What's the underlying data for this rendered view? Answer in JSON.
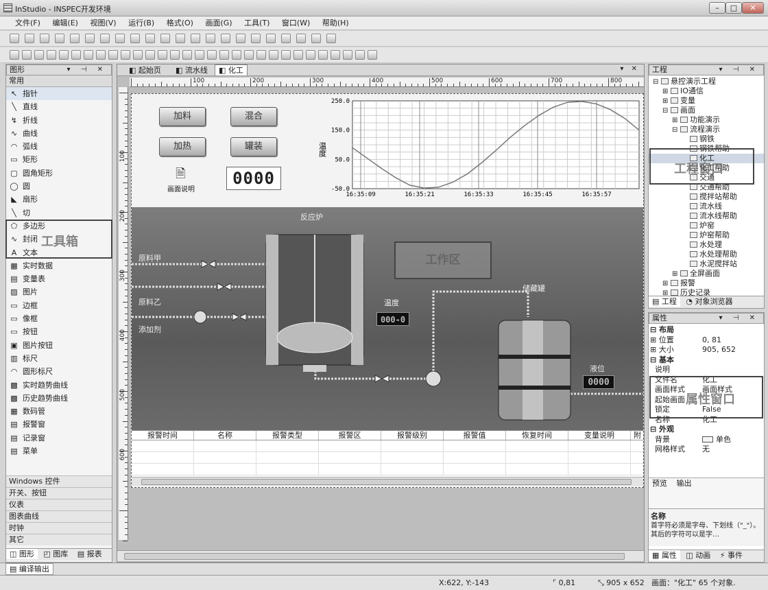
{
  "window": {
    "title": "InStudio - INSPEC开发环境",
    "controls": [
      "–",
      "□",
      "✕"
    ]
  },
  "menu": [
    "文件(F)",
    "编辑(E)",
    "视图(V)",
    "运行(B)",
    "格式(O)",
    "画面(G)",
    "工具(T)",
    "窗口(W)",
    "帮助(H)"
  ],
  "toolbox": {
    "title": "图形",
    "section": "常用",
    "items": [
      "指针",
      "直线",
      "折线",
      "曲线",
      "弧线",
      "矩形",
      "圆角矩形",
      "圆",
      "扇形",
      "切",
      "多边形",
      "封闭",
      "文本",
      "实时数据",
      "变量表",
      "图片",
      "边框",
      "像框",
      "按钮",
      "图片按钮",
      "标尺",
      "圆形标尺",
      "实时趋势曲线",
      "历史趋势曲线",
      "数码管",
      "报警窗",
      "记录窗",
      "菜单"
    ],
    "icons": [
      "pointer-icon",
      "line-icon",
      "polyline-icon",
      "curve-icon",
      "arc-icon",
      "rect-icon",
      "roundrect-icon",
      "circle-icon",
      "pie-icon",
      "chord-icon",
      "polygon-icon",
      "closed-curve-icon",
      "text-icon",
      "realtime-data-icon",
      "var-table-icon",
      "picture-icon",
      "border-icon",
      "frame-icon",
      "button-icon",
      "picture-button-icon",
      "ruler-icon",
      "circle-ruler-icon",
      "realtime-trend-icon",
      "history-trend-icon",
      "digital-tube-icon",
      "alarm-window-icon",
      "record-window-icon",
      "menu-icon"
    ],
    "glyphs": [
      "↖",
      "╲",
      "↯",
      "∿",
      "◠",
      "▭",
      "▢",
      "◯",
      "◣",
      "╲",
      "⬠",
      "∿",
      "A",
      "▦",
      "▤",
      "▨",
      "▭",
      "▭",
      "▭",
      "▣",
      "▥",
      "◠",
      "▩",
      "▩",
      "▦",
      "▤",
      "▤",
      "▤"
    ],
    "overlay": "工具箱",
    "categories": [
      "Windows 控件",
      "开关、按钮",
      "仪表",
      "图表曲线",
      "时钟",
      "其它"
    ],
    "bottom_tabs": [
      "图形",
      "图库",
      "报表"
    ]
  },
  "doc_tabs": [
    "起始页",
    "流水线",
    "化工"
  ],
  "ruler": {
    "h_labels": [
      "100",
      "200",
      "300",
      "400",
      "500",
      "600",
      "700",
      "800"
    ],
    "v_labels": [
      "100",
      "200",
      "300",
      "400",
      "500",
      "600"
    ]
  },
  "canvas": {
    "buttons": [
      "加料",
      "混合",
      "加热",
      "罐装"
    ],
    "help_label": "画面说明",
    "counter": "0000",
    "reactor_label": "反应炉",
    "materials": [
      "原料甲",
      "原料乙",
      "添加剂"
    ],
    "temp_label": "温度",
    "temp_value": "000-0",
    "tank_label": "储藏罐",
    "level_label": "液位",
    "level_value": "0000",
    "work_area": "工作区",
    "alarm_cols": [
      "报警时间",
      "名称",
      "报警类型",
      "报警区",
      "报警级别",
      "报警值",
      "恢复时间",
      "变量说明",
      "附"
    ]
  },
  "chart_data": {
    "type": "line",
    "ylabel": "温度",
    "y_ticks": [
      "250.0",
      "150.0",
      "50.0",
      "-50.0"
    ],
    "x_ticks": [
      "16:35:09",
      "16:35:21",
      "16:35:33",
      "16:35:45",
      "16:35:57"
    ],
    "ylim": [
      -50,
      250
    ],
    "series": [
      {
        "x": [
          0,
          0.05,
          0.1,
          0.15,
          0.2,
          0.25,
          0.3,
          0.35,
          0.4,
          0.45,
          0.5,
          0.55,
          0.6,
          0.65,
          0.7,
          0.75,
          0.8,
          0.85,
          0.9,
          0.95,
          1.0
        ],
        "values": [
          90,
          55,
          20,
          -12,
          -38,
          -48,
          -45,
          -28,
          0,
          38,
          80,
          125,
          165,
          200,
          228,
          245,
          248,
          240,
          220,
          190,
          150
        ]
      }
    ],
    "grid": true
  },
  "project": {
    "title": "工程",
    "overlay": "工程窗口",
    "tree": [
      {
        "d": 0,
        "t": "悬控演示工程",
        "i": "⊟"
      },
      {
        "d": 1,
        "t": "IO通信",
        "i": "⊞"
      },
      {
        "d": 1,
        "t": "变量",
        "i": "⊞"
      },
      {
        "d": 1,
        "t": "画面",
        "i": "⊟"
      },
      {
        "d": 2,
        "t": "功能演示",
        "i": "⊞"
      },
      {
        "d": 2,
        "t": "流程演示",
        "i": "⊟"
      },
      {
        "d": 3,
        "t": "钢铁",
        "i": ""
      },
      {
        "d": 3,
        "t": "钢铁帮助",
        "i": ""
      },
      {
        "d": 3,
        "t": "化工",
        "i": ""
      },
      {
        "d": 3,
        "t": "化工帮助",
        "i": ""
      },
      {
        "d": 3,
        "t": "交通",
        "i": ""
      },
      {
        "d": 3,
        "t": "交通帮助",
        "i": ""
      },
      {
        "d": 3,
        "t": "搅拌站帮助",
        "i": ""
      },
      {
        "d": 3,
        "t": "流水线",
        "i": ""
      },
      {
        "d": 3,
        "t": "流水线帮助",
        "i": ""
      },
      {
        "d": 3,
        "t": "炉窑",
        "i": ""
      },
      {
        "d": 3,
        "t": "炉窑帮助",
        "i": ""
      },
      {
        "d": 3,
        "t": "水处理",
        "i": ""
      },
      {
        "d": 3,
        "t": "水处理帮助",
        "i": ""
      },
      {
        "d": 3,
        "t": "水泥搅拌站",
        "i": ""
      },
      {
        "d": 2,
        "t": "全屏画面",
        "i": "⊞"
      },
      {
        "d": 1,
        "t": "报警",
        "i": "⊞"
      },
      {
        "d": 1,
        "t": "历史记录",
        "i": "⊞"
      }
    ],
    "tabs": [
      "工程",
      "对象浏览器"
    ]
  },
  "properties": {
    "title": "属性",
    "overlay": "属性窗口",
    "rows": [
      {
        "k": "⊟ 布局",
        "v": "",
        "b": true
      },
      {
        "k": "⊞ 位置",
        "v": "0, 81"
      },
      {
        "k": "⊞ 大小",
        "v": "905, 652"
      },
      {
        "k": "⊟ 基本",
        "v": "",
        "b": true
      },
      {
        "k": "  说明",
        "v": ""
      },
      {
        "k": "  文件名",
        "v": "化工"
      },
      {
        "k": "  画面样式",
        "v": "画面样式"
      },
      {
        "k": "  起始画面",
        "v": ""
      },
      {
        "k": "  锁定",
        "v": "False"
      },
      {
        "k": "  名称",
        "v": "化工"
      },
      {
        "k": "⊟ 外观",
        "v": "",
        "b": true
      },
      {
        "k": "  背景",
        "v": "单色"
      },
      {
        "k": "  网格样式",
        "v": "无"
      }
    ],
    "sub_tabs": [
      "预览",
      "输出"
    ],
    "desc_title": "名称",
    "desc_text": "首字符必须是字母、下划线（\"_\"）。其后的字符可以是字…",
    "tabs": [
      "属性",
      "动画",
      "事件"
    ]
  },
  "output_tab": "编译输出",
  "status": {
    "coords": "X:622, Y:-143",
    "pos": "0,81",
    "size": "905 x 652",
    "info": "画面：\"化工\" 65 个对象."
  }
}
